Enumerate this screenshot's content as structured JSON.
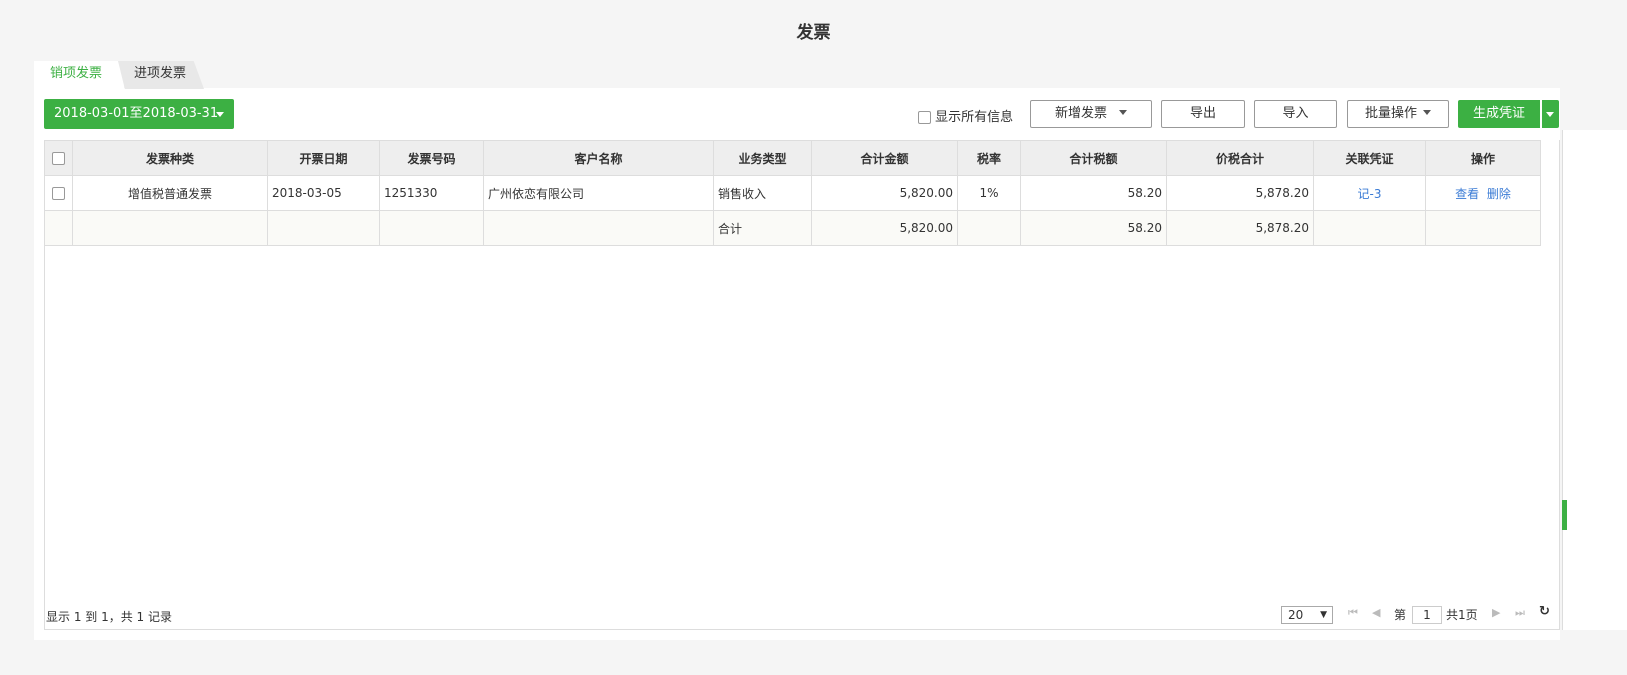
{
  "title": "发票",
  "tabs": [
    {
      "label": "销项发票"
    },
    {
      "label": "进项发票"
    }
  ],
  "toolbar": {
    "date_range": "2018-03-01至2018-03-31",
    "show_all": "显示所有信息",
    "new_invoice": "新增发票",
    "export": "导出",
    "import": "导入",
    "batch": "批量操作",
    "generate": "生成凭证"
  },
  "table": {
    "headers": [
      "发票种类",
      "开票日期",
      "发票号码",
      "客户名称",
      "业务类型",
      "合计金额",
      "税率",
      "合计税额",
      "价税合计",
      "关联凭证",
      "操作"
    ],
    "rows": [
      {
        "type": "增值税普通发票",
        "date": "2018-03-05",
        "number": "1251330",
        "customer": "广州依恋有限公司",
        "business": "销售收入",
        "amount": "5,820.00",
        "rate": "1%",
        "tax": "58.20",
        "total": "5,878.20",
        "voucher": "记-3",
        "view": "查看",
        "delete": "删除"
      }
    ],
    "summary": {
      "label": "合计",
      "amount": "5,820.00",
      "tax": "58.20",
      "total": "5,878.20"
    }
  },
  "footer": {
    "records": "显示 1 到 1，共 1 记录",
    "page_size": "20",
    "page_prefix": "第",
    "page": "1",
    "page_total": "共1页"
  },
  "colors": {
    "accent": "#3cb043",
    "link": "#3a7bd5"
  }
}
